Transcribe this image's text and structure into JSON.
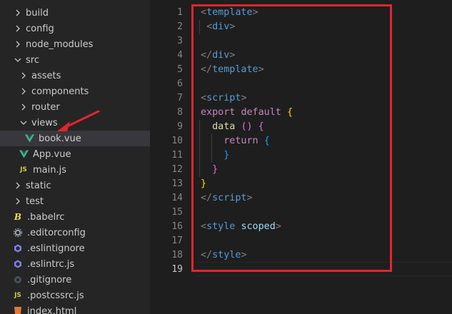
{
  "colors": {
    "sidebar_bg": "#252526",
    "editor_bg": "#1e1e1e",
    "selected_row": "#37373d",
    "highlight_box": "#e0262c",
    "vue_green": "#41b883",
    "js_yellow": "#cbcb41"
  },
  "explorer": {
    "items": [
      {
        "label": "build",
        "type": "folder",
        "state": "collapsed",
        "icon": "chevron-right-icon"
      },
      {
        "label": "config",
        "type": "folder",
        "state": "collapsed",
        "icon": "chevron-right-icon"
      },
      {
        "label": "node_modules",
        "type": "folder",
        "state": "collapsed",
        "icon": "chevron-right-icon"
      },
      {
        "label": "src",
        "type": "folder",
        "state": "expanded",
        "icon": "chevron-down-icon"
      },
      {
        "label": "assets",
        "type": "folder",
        "state": "collapsed",
        "icon": "chevron-right-icon"
      },
      {
        "label": "components",
        "type": "folder",
        "state": "collapsed",
        "icon": "chevron-right-icon"
      },
      {
        "label": "router",
        "type": "folder",
        "state": "collapsed",
        "icon": "chevron-right-icon"
      },
      {
        "label": "views",
        "type": "folder",
        "state": "expanded",
        "icon": "chevron-down-icon"
      },
      {
        "label": "book.vue",
        "type": "file",
        "icon": "vue-file-icon",
        "selected": true
      },
      {
        "label": "App.vue",
        "type": "file",
        "icon": "vue-file-icon"
      },
      {
        "label": "main.js",
        "type": "file",
        "icon": "js-file-icon",
        "icon_text": "JS"
      },
      {
        "label": "static",
        "type": "folder",
        "state": "collapsed",
        "icon": "chevron-right-icon"
      },
      {
        "label": "test",
        "type": "folder",
        "state": "collapsed",
        "icon": "chevron-right-icon"
      },
      {
        "label": ".babelrc",
        "type": "file",
        "icon": "babel-file-icon",
        "icon_text": "B"
      },
      {
        "label": ".editorconfig",
        "type": "file",
        "icon": "gear-icon"
      },
      {
        "label": ".eslintignore",
        "type": "file",
        "icon": "eslint-icon"
      },
      {
        "label": ".eslintrc.js",
        "type": "file",
        "icon": "eslint-icon"
      },
      {
        "label": ".gitignore",
        "type": "file",
        "icon": "git-icon"
      },
      {
        "label": ".postcssrc.js",
        "type": "file",
        "icon": "js-file-icon",
        "icon_text": "JS"
      },
      {
        "label": "index.html",
        "type": "file",
        "icon": "html-file-icon"
      }
    ]
  },
  "editor": {
    "line_numbers": [
      "1",
      "2",
      "3",
      "4",
      "5",
      "6",
      "7",
      "8",
      "9",
      "10",
      "11",
      "12",
      "13",
      "14",
      "15",
      "16",
      "17",
      "18",
      "19"
    ],
    "current_line": "19",
    "lines": [
      [
        [
          "tag",
          "<"
        ],
        [
          "tname",
          "template"
        ],
        [
          "tag",
          ">"
        ]
      ],
      [
        [
          "plain",
          " "
        ],
        [
          "tag",
          "<"
        ],
        [
          "tname",
          "div"
        ],
        [
          "tag",
          ">"
        ]
      ],
      [],
      [
        [
          "tag",
          "</"
        ],
        [
          "tname",
          "div"
        ],
        [
          "tag",
          ">"
        ]
      ],
      [
        [
          "tag",
          "</"
        ],
        [
          "tname",
          "template"
        ],
        [
          "tag",
          ">"
        ]
      ],
      [],
      [
        [
          "tag",
          "<"
        ],
        [
          "tname",
          "script"
        ],
        [
          "tag",
          ">"
        ]
      ],
      [
        [
          "kw",
          "export"
        ],
        [
          "plain",
          " "
        ],
        [
          "kw",
          "default"
        ],
        [
          "plain",
          " "
        ],
        [
          "br1",
          "{"
        ]
      ],
      [
        [
          "plain",
          "  "
        ],
        [
          "fn",
          "data"
        ],
        [
          "plain",
          " "
        ],
        [
          "br2",
          "()"
        ],
        [
          "plain",
          " "
        ],
        [
          "br2",
          "{"
        ]
      ],
      [
        [
          "plain",
          "    "
        ],
        [
          "kw",
          "return"
        ],
        [
          "plain",
          " "
        ],
        [
          "br3",
          "{"
        ]
      ],
      [
        [
          "plain",
          "    "
        ],
        [
          "br3",
          "}"
        ]
      ],
      [
        [
          "plain",
          "  "
        ],
        [
          "br2",
          "}"
        ]
      ],
      [
        [
          "br1",
          "}"
        ]
      ],
      [
        [
          "tag",
          "</"
        ],
        [
          "tname",
          "script"
        ],
        [
          "tag",
          ">"
        ]
      ],
      [],
      [
        [
          "tag",
          "<"
        ],
        [
          "tname",
          "style"
        ],
        [
          "plain",
          " "
        ],
        [
          "attr",
          "scoped"
        ],
        [
          "tag",
          ">"
        ]
      ],
      [],
      [
        [
          "tag",
          "</"
        ],
        [
          "tname",
          "style"
        ],
        [
          "tag",
          ">"
        ]
      ],
      []
    ]
  }
}
